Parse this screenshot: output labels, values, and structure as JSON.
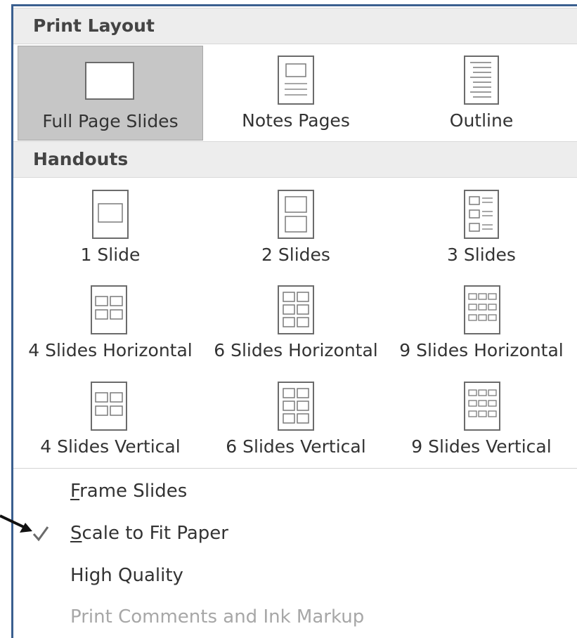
{
  "print_layout": {
    "header": "Print Layout",
    "items": [
      {
        "label": "Full Page Slides",
        "icon": "full-page-slide-icon",
        "selected": true
      },
      {
        "label": "Notes Pages",
        "icon": "notes-page-icon",
        "selected": false
      },
      {
        "label": "Outline",
        "icon": "outline-icon",
        "selected": false
      }
    ]
  },
  "handouts": {
    "header": "Handouts",
    "items": [
      {
        "label": "1 Slide",
        "icon": "handout-1-slide-icon"
      },
      {
        "label": "2 Slides",
        "icon": "handout-2-slides-icon"
      },
      {
        "label": "3 Slides",
        "icon": "handout-3-slides-icon"
      },
      {
        "label": "4 Slides Horizontal",
        "icon": "handout-4-horizontal-icon"
      },
      {
        "label": "6 Slides Horizontal",
        "icon": "handout-6-horizontal-icon"
      },
      {
        "label": "9 Slides Horizontal",
        "icon": "handout-9-horizontal-icon"
      },
      {
        "label": "4 Slides Vertical",
        "icon": "handout-4-vertical-icon"
      },
      {
        "label": "6 Slides Vertical",
        "icon": "handout-6-vertical-icon"
      },
      {
        "label": "9 Slides Vertical",
        "icon": "handout-9-vertical-icon"
      }
    ]
  },
  "options": [
    {
      "first": "F",
      "rest": "rame Slides",
      "checked": false,
      "enabled": true
    },
    {
      "first": "S",
      "rest": "cale to Fit Paper",
      "checked": true,
      "enabled": true
    },
    {
      "first": "",
      "rest": "High Quality",
      "checked": false,
      "enabled": true
    },
    {
      "first": "",
      "rest": "Print Comments and Ink Markup",
      "checked": false,
      "enabled": false
    }
  ],
  "colors": {
    "window_border": "#3a5f8f",
    "header_bg": "#ededed",
    "selected_bg": "#c6c6c6",
    "disabled_text": "#a7a7a7"
  },
  "annotation": {
    "icon": "arrow-icon",
    "points_to": "Scale to Fit Paper"
  }
}
